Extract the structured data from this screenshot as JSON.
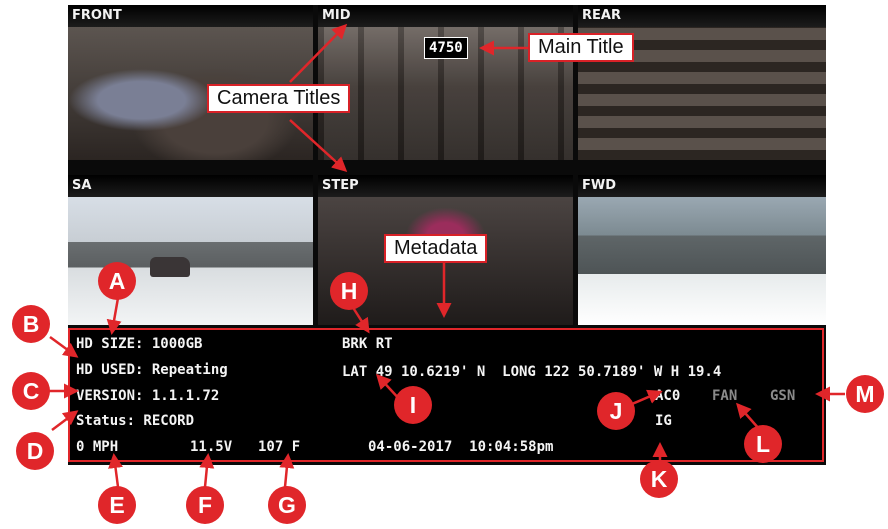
{
  "cameras": [
    {
      "title": "FRONT"
    },
    {
      "title": "MID"
    },
    {
      "title": "REAR"
    },
    {
      "title": "SA"
    },
    {
      "title": "STEP"
    },
    {
      "title": "FWD"
    }
  ],
  "main_title": "4750",
  "callouts": {
    "main_title": "Main Title",
    "camera_titles": "Camera Titles",
    "metadata": "Metadata"
  },
  "metadata": {
    "hd_size": "HD SIZE: 1000GB",
    "hd_used": "HD USED: Repeating",
    "version": "VERSION: 1.1.1.72",
    "status": "Status: RECORD",
    "speed": "0 MPH",
    "voltage": "11.5V",
    "temp": "107 F",
    "datetime": "04-06-2017  10:04:58pm",
    "brake": "BRK RT",
    "gps": "LAT 49 10.6219' N  LONG 122 50.7189' W H 19.4",
    "ac": "AC0",
    "ig": "IG",
    "fan": "FAN",
    "gsn": "GSN"
  },
  "badges": [
    "A",
    "B",
    "C",
    "D",
    "E",
    "F",
    "G",
    "H",
    "I",
    "J",
    "K",
    "L",
    "M"
  ],
  "colors": {
    "accent": "#e0262a",
    "frame": "#000000"
  }
}
